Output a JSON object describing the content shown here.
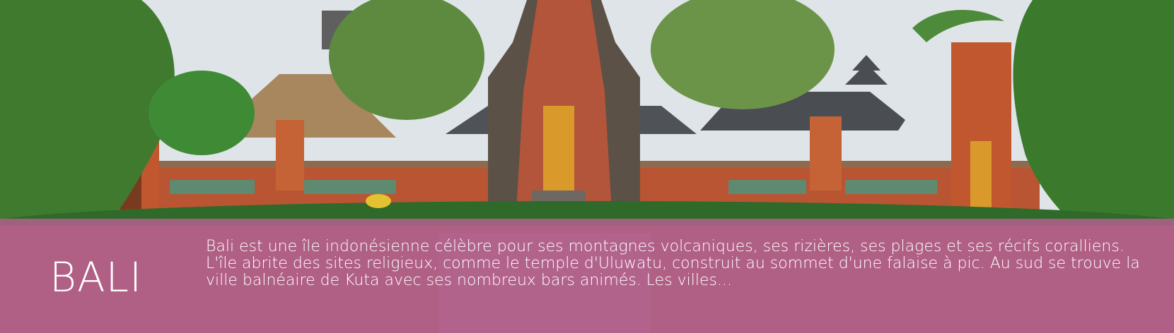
{
  "banner": {
    "title": "BALI",
    "description": "Bali est une île indonésienne célèbre pour ses montagnes volcaniques, ses rizières, ses plages et ses récifs coralliens. L'île abrite des sites religieux, comme le temple d'Uluwatu, construit au sommet d'une falaise à pic. Au sud se trouve la ville balnéaire de Kuta avec ses nombreux bars animés. Les villes..."
  },
  "colors": {
    "overlay": "#be6096",
    "text": "#ffffff",
    "sky": "#dfe4e8",
    "foliage": "#3f7a2e",
    "temple_brick": "#c0572e",
    "gate_gold": "#d99a2b"
  },
  "image": {
    "subject": "temple-photo"
  }
}
